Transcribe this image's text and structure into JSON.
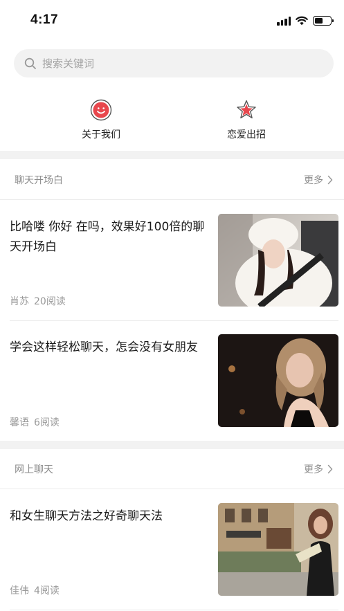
{
  "status_bar": {
    "time": "4:17"
  },
  "search": {
    "placeholder": "搜索关键词"
  },
  "quick_links": [
    {
      "label": "关于我们",
      "icon": "smiley-icon",
      "color": "#e8474d"
    },
    {
      "label": "恋爱出招",
      "icon": "star-icon",
      "color": "#e8474d"
    }
  ],
  "sections": [
    {
      "title": "聊天开场白",
      "more_label": "更多",
      "articles": [
        {
          "title": "比哈喽 你好 在吗，效果好100倍的聊天开场白",
          "author": "肖苏",
          "reads": "20阅读",
          "thumb": "snowy-portrait-photo"
        },
        {
          "title": "学会这样轻松聊天，怎会没有女朋友",
          "author": "馨语",
          "reads": "6阅读",
          "thumb": "dark-portrait-photo"
        }
      ]
    },
    {
      "title": "网上聊天",
      "more_label": "更多",
      "articles": [
        {
          "title": "和女生聊天方法之好奇聊天法",
          "author": "佳伟",
          "reads": "4阅读",
          "thumb": "street-portrait-photo"
        }
      ]
    }
  ],
  "colors": {
    "accent": "#e8474d",
    "divider": "#f2f2f2",
    "muted_text": "#999999"
  }
}
